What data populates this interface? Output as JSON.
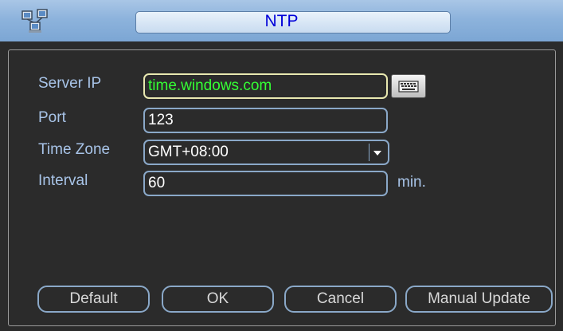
{
  "window": {
    "title": "NTP",
    "app_icon": "network-icon"
  },
  "form": {
    "server_ip_label": "Server IP",
    "server_ip_value": "time.windows.com",
    "keyboard_icon": "keyboard-icon",
    "port_label": "Port",
    "port_value": "123",
    "time_zone_label": "Time Zone",
    "time_zone_value": "GMT+08:00",
    "interval_label": "Interval",
    "interval_value": "60",
    "interval_unit": "min."
  },
  "buttons": {
    "default": "Default",
    "ok": "OK",
    "cancel": "Cancel",
    "manual_update": "Manual Update"
  },
  "colors": {
    "background": "#2b2b2b",
    "titlebar": "#8db3dc",
    "title_text": "#0000d8",
    "label_text": "#a8c4e8",
    "active_value_text": "#34ff34",
    "field_border": "#8aa8c8"
  }
}
